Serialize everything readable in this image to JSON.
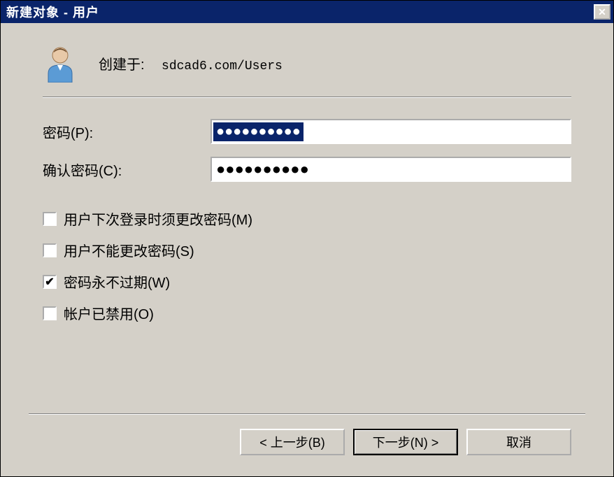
{
  "titlebar": {
    "title": "新建对象 - 用户",
    "close": "✕"
  },
  "header": {
    "create_label": "创建于:",
    "create_path": "sdcad6.com/Users"
  },
  "form": {
    "password_label": "密码(P):",
    "password_value": "●●●●●●●●●●",
    "confirm_label": "确认密码(C):",
    "confirm_value": "●●●●●●●●●●"
  },
  "checkboxes": {
    "must_change": {
      "label": "用户下次登录时须更改密码(M)",
      "checked": false
    },
    "cannot_change": {
      "label": "用户不能更改密码(S)",
      "checked": false
    },
    "never_expires": {
      "label": "密码永不过期(W)",
      "checked": true
    },
    "disabled": {
      "label": "帐户已禁用(O)",
      "checked": false
    }
  },
  "buttons": {
    "back": "< 上一步(B)",
    "next": "下一步(N) >",
    "cancel": "取消"
  },
  "checkmark": "✔"
}
